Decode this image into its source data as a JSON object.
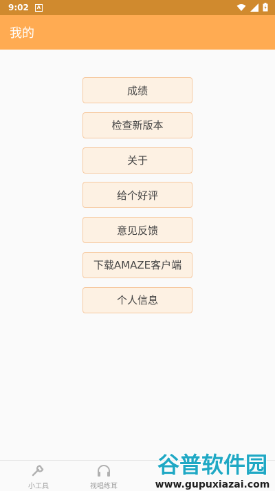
{
  "status": {
    "time": "9:02",
    "notif_letter": "A"
  },
  "app": {
    "title": "我的",
    "accent": "#ffab52"
  },
  "menu": {
    "items": [
      {
        "label": "成绩"
      },
      {
        "label": "检查新版本"
      },
      {
        "label": "关于"
      },
      {
        "label": "给个好评"
      },
      {
        "label": "意见反馈"
      },
      {
        "label": "下载AMAZE客户端"
      },
      {
        "label": "个人信息"
      }
    ]
  },
  "bottom_nav": {
    "items": [
      {
        "label": "小工具",
        "icon": "wrench-icon"
      },
      {
        "label": "视唱练耳",
        "icon": "headphones-icon"
      }
    ]
  },
  "watermark": {
    "title": "谷普软件园",
    "url": "www.gupuxiazai.com"
  }
}
